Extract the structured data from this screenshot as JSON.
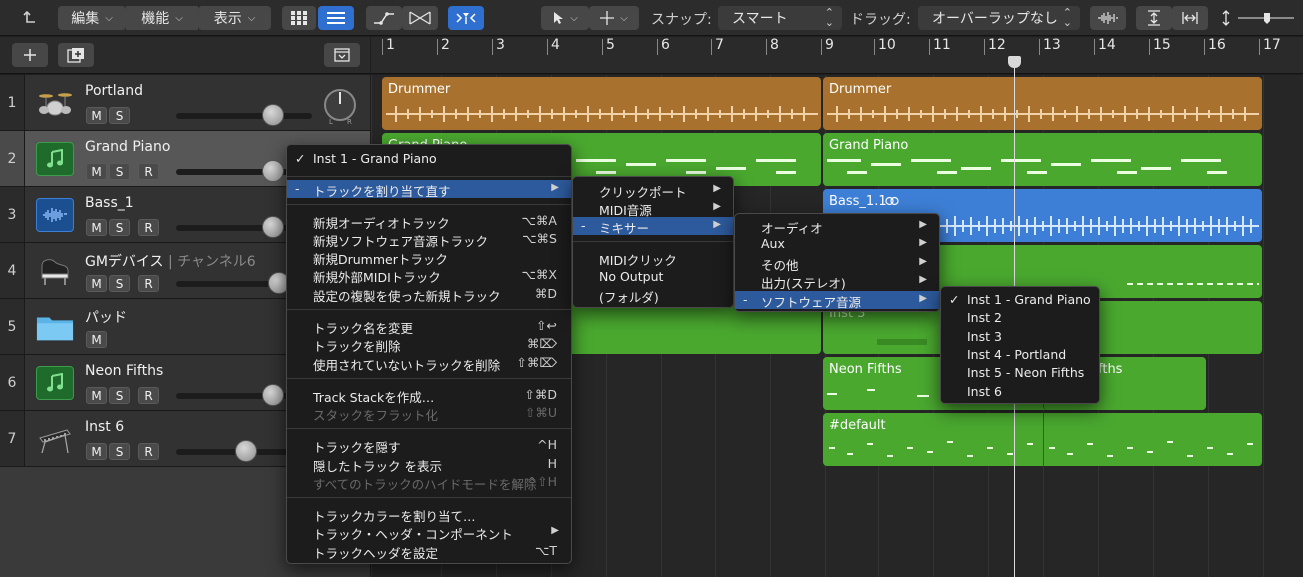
{
  "toolbar": {
    "edit_label": "編集",
    "functions_label": "機能",
    "view_label": "表示",
    "snap_label": "スナップ:",
    "snap_value": "スマート",
    "drag_label": "ドラッグ:",
    "drag_value": "オーバーラップなし"
  },
  "ruler": [
    "1",
    "2",
    "3",
    "4",
    "5",
    "6",
    "7",
    "8",
    "9",
    "10",
    "11",
    "12",
    "13",
    "14",
    "15",
    "16",
    "17"
  ],
  "tracks": [
    {
      "num": "1",
      "name": "Portland",
      "sub": "",
      "buttons": [
        "M",
        "S"
      ]
    },
    {
      "num": "2",
      "name": "Grand Piano",
      "sub": "",
      "buttons": [
        "M",
        "S",
        "R"
      ]
    },
    {
      "num": "3",
      "name": "Bass_1",
      "sub": "",
      "buttons": [
        "M",
        "S",
        "R"
      ]
    },
    {
      "num": "4",
      "name": "GMデバイス",
      "sub": "| チャンネル6",
      "buttons": [
        "M",
        "S",
        "R"
      ]
    },
    {
      "num": "5",
      "name": "パッド",
      "sub": "",
      "buttons": [
        "M"
      ]
    },
    {
      "num": "6",
      "name": "Neon Fifths",
      "sub": "",
      "buttons": [
        "M",
        "S",
        "R"
      ]
    },
    {
      "num": "7",
      "name": "Inst 6",
      "sub": "",
      "buttons": [
        "M",
        "S",
        "R"
      ]
    }
  ],
  "pan": {
    "l": "L",
    "r": "R"
  },
  "regions": {
    "drummer1": "Drummer",
    "drummer2": "Drummer",
    "piano1": "Grand Piano",
    "piano2": "Grand Piano",
    "bass": "Bass_1.1",
    "inst3": "Inst 3",
    "neon": "Neon Fifths",
    "neon_tail": "fths",
    "default": "#default"
  },
  "context_menu": {
    "items": [
      {
        "label": "Inst 1 - Grand Piano",
        "mark": "✓",
        "shortcut": ""
      },
      {
        "label": "トラックを割り当て直す",
        "mark": "-",
        "submenu": true,
        "highlight": true
      },
      {
        "label": "新規オーディオトラック",
        "shortcut": "⌥⌘A"
      },
      {
        "label": "新規ソフトウェア音源トラック",
        "shortcut": "⌥⌘S"
      },
      {
        "label": "新規Drummerトラック",
        "shortcut": ""
      },
      {
        "label": "新規外部MIDIトラック",
        "shortcut": "⌥⌘X"
      },
      {
        "label": "設定の複製を使った新規トラック",
        "shortcut": "⌘D"
      },
      {
        "label": "トラック名を変更",
        "shortcut": "⇧↩"
      },
      {
        "label": "トラックを削除",
        "shortcut": "⌘⌦"
      },
      {
        "label": "使用されていないトラックを削除",
        "shortcut": "⇧⌘⌦"
      },
      {
        "label": "Track Stackを作成…",
        "shortcut": "⇧⌘D"
      },
      {
        "label": "スタックをフラット化",
        "shortcut": "⇧⌘U",
        "disabled": true
      },
      {
        "label": "トラックを隠す",
        "shortcut": "^H"
      },
      {
        "label": "隠したトラック を表示",
        "shortcut": "H"
      },
      {
        "label": "すべてのトラックのハイドモードを解除",
        "shortcut": "^⇧H",
        "disabled": true
      },
      {
        "label": "トラックカラーを割り当て…",
        "shortcut": ""
      },
      {
        "label": "トラック・ヘッダ・コンポーネント",
        "submenu": true
      },
      {
        "label": "トラックヘッダを設定",
        "shortcut": "⌥T"
      }
    ]
  },
  "submenu1": [
    "クリックポート",
    "MIDI音源",
    "ミキサー",
    "MIDIクリック",
    "No Output",
    "(フォルダ)"
  ],
  "submenu1_mark": "-",
  "submenu2": [
    "オーディオ",
    "Aux",
    "その他",
    "出力(ステレオ)",
    "ソフトウェア音源"
  ],
  "submenu2_mark": "-",
  "submenu3": [
    "Inst 1 - Grand Piano",
    "Inst 2",
    "Inst 3",
    "Inst 4 - Portland",
    "Inst 5 - Neon Fifths",
    "Inst 6"
  ],
  "submenu3_mark": "✓",
  "colors": {
    "drummer": "#a8722e",
    "green": "#4aa82f",
    "blue": "#3d7fd6",
    "highlight": "#2d5a9c"
  }
}
